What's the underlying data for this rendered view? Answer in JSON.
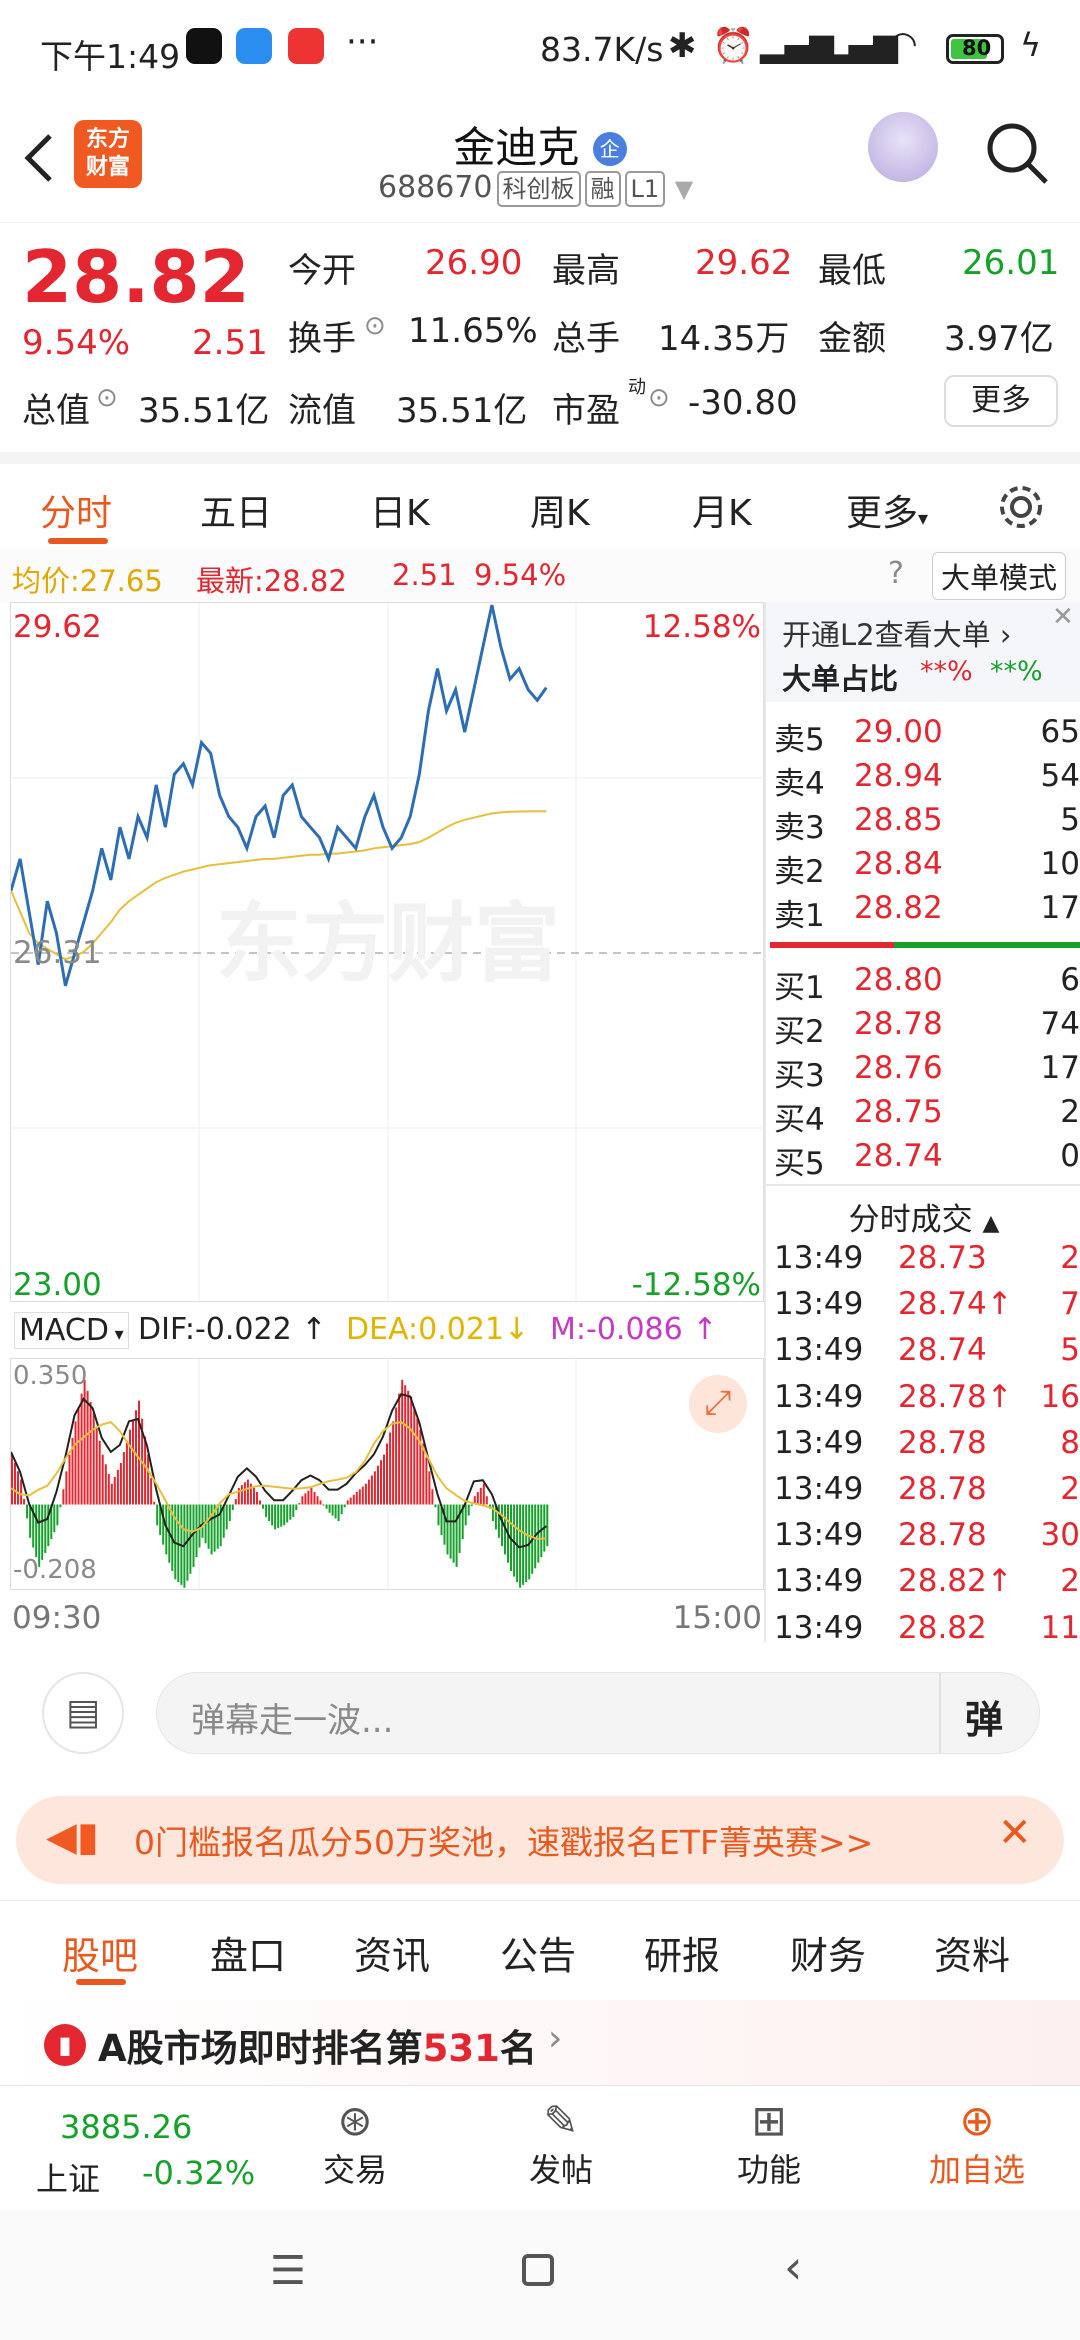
{
  "status": {
    "time": "下午1:49",
    "net_speed": "83.7K/s",
    "battery": "80"
  },
  "header": {
    "logo_text": "东方财富",
    "name": "金迪克",
    "corp_badge": "企",
    "code": "688670",
    "tags": [
      "科创板",
      "融",
      "L1"
    ]
  },
  "quote": {
    "price": "28.82",
    "change_pct": "9.54%",
    "change": "2.51",
    "labels": {
      "open": "今开",
      "high": "最高",
      "low": "最低",
      "turnover": "换手",
      "volume": "总手",
      "amount": "金额",
      "mktcap": "总值",
      "float": "流值",
      "pe": "市盈",
      "pe_sup": "动"
    },
    "open": "26.90",
    "high": "29.62",
    "low": "26.01",
    "turnover": "11.65%",
    "volume": "14.35万",
    "amount": "3.97亿",
    "mktcap": "35.51亿",
    "float": "35.51亿",
    "pe": "-30.80",
    "more": "更多"
  },
  "ktabs": {
    "items": [
      "分时",
      "五日",
      "日K",
      "周K",
      "月K",
      "更多"
    ],
    "active": 0
  },
  "chart_info": {
    "avg_label": "均价:",
    "avg": "27.65",
    "latest_label": "最新:",
    "latest": "28.82",
    "chg": "2.51",
    "pct": "9.54%",
    "big_order_mode": "大单模式"
  },
  "chart_data": {
    "type": "line",
    "y_axis_left": {
      "top": "29.62",
      "mid": "26.31",
      "bottom": "23.00"
    },
    "y_axis_right": {
      "top": "12.58%",
      "bottom": "-12.58%"
    },
    "x_axis": {
      "start": "09:30",
      "end": "15:00"
    },
    "ylim": [
      23.0,
      29.62
    ],
    "prev_close": 26.31,
    "watermark": "东方财富",
    "series": [
      {
        "values": [
          26.9,
          27.2,
          26.7,
          26.2,
          26.8,
          26.5,
          26.0,
          26.3,
          26.6,
          26.9,
          27.3,
          27.0,
          27.5,
          27.2,
          27.6,
          27.4,
          27.9,
          27.5,
          28.0,
          28.1,
          27.9,
          28.3,
          28.2,
          27.8,
          27.6,
          27.5,
          27.3,
          27.6,
          27.7,
          27.4,
          27.8,
          27.9,
          27.6,
          27.5,
          27.4,
          27.2,
          27.5,
          27.4,
          27.3,
          27.6,
          27.8,
          27.5,
          27.3,
          27.4,
          27.6,
          28.0,
          28.6,
          29.0,
          28.6,
          28.8,
          28.4,
          28.8,
          29.2,
          29.6,
          29.2,
          28.9,
          29.0,
          28.8,
          28.7,
          28.82
        ]
      },
      {
        "values": [
          26.9,
          26.7,
          26.5,
          26.4,
          26.35,
          26.3,
          26.25,
          26.28,
          26.32,
          26.4,
          26.5,
          26.6,
          26.72,
          26.8,
          26.86,
          26.92,
          26.98,
          27.02,
          27.05,
          27.08,
          27.1,
          27.12,
          27.14,
          27.15,
          27.16,
          27.17,
          27.18,
          27.19,
          27.2,
          27.2,
          27.21,
          27.22,
          27.23,
          27.24,
          27.24,
          27.25,
          27.25,
          27.26,
          27.27,
          27.28,
          27.3,
          27.31,
          27.32,
          27.33,
          27.34,
          27.36,
          27.4,
          27.45,
          27.5,
          27.54,
          27.57,
          27.59,
          27.61,
          27.63,
          27.64,
          27.645,
          27.648,
          27.649,
          27.65,
          27.65
        ]
      }
    ],
    "macd": {
      "label": "MACD",
      "dif": "DIF:-0.022",
      "dea": "DEA:0.021",
      "m": "M:-0.086",
      "top": "0.350",
      "bottom": "-0.208",
      "values": [
        0.12,
        0.06,
        -0.08,
        -0.15,
        -0.1,
        -0.05,
        0.08,
        0.2,
        0.3,
        0.22,
        0.12,
        0.05,
        0.1,
        0.18,
        0.25,
        0.12,
        -0.05,
        -0.12,
        -0.18,
        -0.2,
        -0.15,
        -0.08,
        -0.12,
        -0.1,
        -0.04,
        0.04,
        0.06,
        0.03,
        -0.03,
        -0.06,
        -0.05,
        -0.03,
        0.02,
        0.04,
        0.01,
        -0.02,
        -0.04,
        0.01,
        0.03,
        0.05,
        0.08,
        0.12,
        0.2,
        0.3,
        0.26,
        0.18,
        0.08,
        -0.05,
        -0.12,
        -0.15,
        -0.05,
        0.02,
        0.05,
        -0.04,
        -0.1,
        -0.16,
        -0.2,
        -0.18,
        -0.14,
        -0.1
      ]
    }
  },
  "book": {
    "open_l2": "开通L2查看大单",
    "big_ratio": "大单占比",
    "ratio_a": "**%",
    "ratio_b": "**%",
    "sell": [
      {
        "l": "卖5",
        "p": "29.00",
        "v": "65"
      },
      {
        "l": "卖4",
        "p": "28.94",
        "v": "54"
      },
      {
        "l": "卖3",
        "p": "28.85",
        "v": "5"
      },
      {
        "l": "卖2",
        "p": "28.84",
        "v": "10"
      },
      {
        "l": "卖1",
        "p": "28.82",
        "v": "17"
      }
    ],
    "buy": [
      {
        "l": "买1",
        "p": "28.80",
        "v": "6"
      },
      {
        "l": "买2",
        "p": "28.78",
        "v": "74"
      },
      {
        "l": "买3",
        "p": "28.76",
        "v": "17"
      },
      {
        "l": "买4",
        "p": "28.75",
        "v": "2"
      },
      {
        "l": "买5",
        "p": "28.74",
        "v": "0"
      }
    ],
    "trades_title": "分时成交",
    "trades": [
      {
        "t": "13:49",
        "p": "28.73",
        "v": "2",
        "up": false
      },
      {
        "t": "13:49",
        "p": "28.74",
        "v": "7",
        "up": true
      },
      {
        "t": "13:49",
        "p": "28.74",
        "v": "5",
        "up": false
      },
      {
        "t": "13:49",
        "p": "28.78",
        "v": "16",
        "up": true
      },
      {
        "t": "13:49",
        "p": "28.78",
        "v": "8",
        "up": false
      },
      {
        "t": "13:49",
        "p": "28.78",
        "v": "2",
        "up": false
      },
      {
        "t": "13:49",
        "p": "28.78",
        "v": "30",
        "up": false
      },
      {
        "t": "13:49",
        "p": "28.82",
        "v": "2",
        "up": true
      },
      {
        "t": "13:49",
        "p": "28.82",
        "v": "11",
        "up": false
      }
    ]
  },
  "danmu": {
    "placeholder": "弹幕走一波...",
    "btn": "弹"
  },
  "banner": {
    "text": "0门槛报名瓜分50万奖池，速戳报名ETF菁英赛>>"
  },
  "ntabs": {
    "items": [
      "股吧",
      "盘口",
      "资讯",
      "公告",
      "研报",
      "财务",
      "资料"
    ],
    "active": 0
  },
  "rank": {
    "prefix": "A股市场即时排名第",
    "num": "531",
    "suffix": "名"
  },
  "bottom": {
    "index_value": "3885.26",
    "index_name": "上证",
    "index_chg": "-0.32%",
    "trade": "交易",
    "post": "发帖",
    "func": "功能",
    "add": "加自选"
  }
}
